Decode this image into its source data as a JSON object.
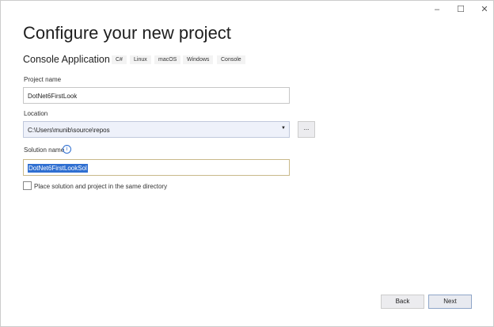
{
  "window": {
    "minimize": "–",
    "maximize": "☐",
    "close": "✕"
  },
  "title": "Configure your new project",
  "template": {
    "name": "Console Application",
    "tags": [
      "C#",
      "Linux",
      "macOS",
      "Windows",
      "Console"
    ]
  },
  "project_name": {
    "label": "Project name",
    "value": "DotNet6FirstLook"
  },
  "location": {
    "label": "Location",
    "value": "C:\\Users\\munib\\source\\repos",
    "browse": "..."
  },
  "solution_name": {
    "label": "Solution name",
    "value": "DotNet6FirstLookSol",
    "info": "i"
  },
  "same_dir": {
    "label": "Place solution and project in the same directory",
    "checked": false
  },
  "buttons": {
    "back": "Back",
    "next": "Next"
  }
}
